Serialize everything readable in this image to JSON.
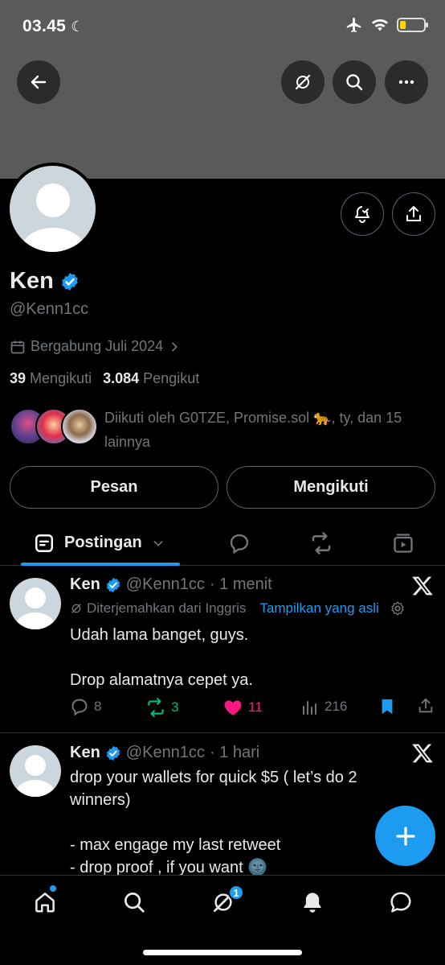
{
  "status_bar": {
    "time": "03.45"
  },
  "profile": {
    "name": "Ken",
    "handle": "@Kenn1cc",
    "joined": "Bergabung Juli 2024",
    "following_count": "39",
    "following_label": "Mengikuti",
    "followers_count": "3.084",
    "followers_label": "Pengikut",
    "followed_by": "Diikuti oleh G0TZE, Promise.sol 🐆, ty, dan 15 lainnya",
    "message_button": "Pesan",
    "follow_button": "Mengikuti"
  },
  "tabs": {
    "active_label": "Postingan"
  },
  "posts": [
    {
      "name": "Ken",
      "handle": "@Kenn1cc",
      "time": "· 1 menit",
      "translated_note": "Diterjemahkan dari Inggris",
      "show_original": "Tampilkan yang asli",
      "text": "Udah lama banget, guys.\n\nDrop alamatnya cepet ya.",
      "replies": "8",
      "reposts": "3",
      "likes": "11",
      "views": "216"
    },
    {
      "name": "Ken",
      "handle": "@Kenn1cc",
      "time": "· 1 hari",
      "text": "drop your wallets for quick $5 ( let’s do 2 winners)\n\n- max engage my last retweet\n- drop proof , if you want 🌚"
    }
  ],
  "bottom_nav": {
    "notif_badge": "1"
  },
  "colors": {
    "accent": "#1d9bf0",
    "like": "#f91880",
    "repost": "#00ba7c",
    "muted": "#71767b"
  }
}
